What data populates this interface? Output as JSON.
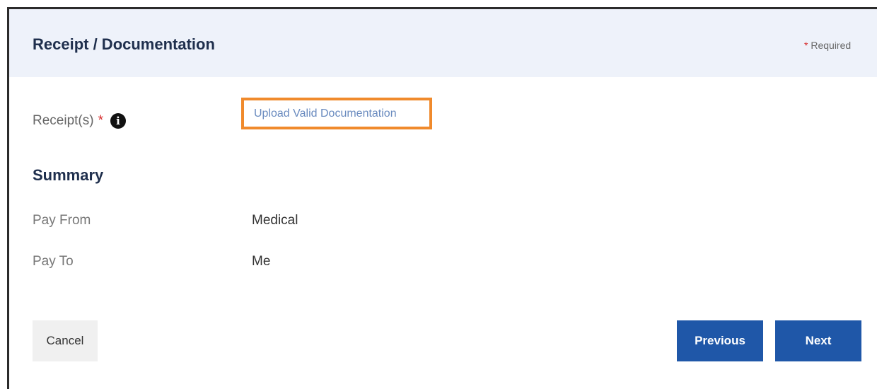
{
  "header": {
    "title": "Receipt / Documentation",
    "required_asterisk": "*",
    "required_label": "Required"
  },
  "receipt_field": {
    "label": "Receipt(s)",
    "required_asterisk": "*",
    "info_icon_glyph": "i",
    "info_icon_name": "info-icon",
    "upload_link": "Upload Valid Documentation",
    "highlight_color": "#f08a2c"
  },
  "summary": {
    "title": "Summary",
    "rows": [
      {
        "label": "Pay From",
        "value": "Medical"
      },
      {
        "label": "Pay To",
        "value": "Me"
      }
    ]
  },
  "buttons": {
    "cancel": "Cancel",
    "previous": "Previous",
    "next": "Next",
    "primary_color": "#1f57a8"
  }
}
